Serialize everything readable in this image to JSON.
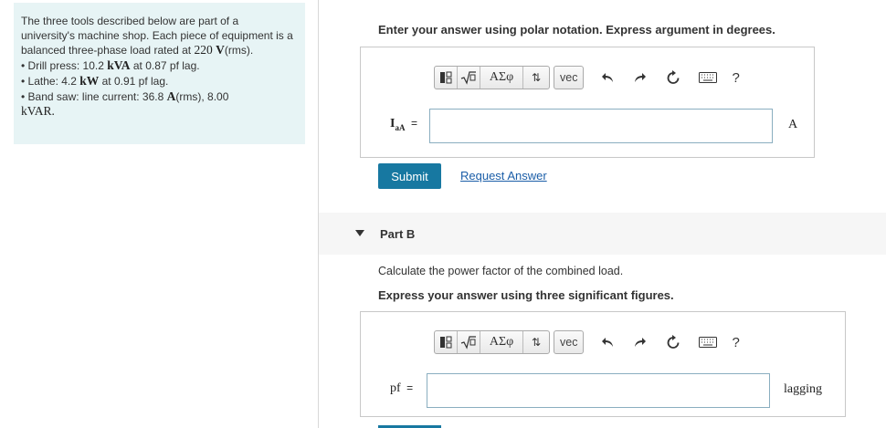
{
  "problem": {
    "intro": "The three tools described below are part of a university's machine shop. Each piece of equipment is a balanced three-phase load rated at",
    "voltage_value": "220",
    "voltage_unit": "V",
    "voltage_suffix": "(rms).",
    "drill_prefix": "• Drill press: 10.2",
    "drill_unit": "kVA",
    "drill_suffix": "at 0.87 pf lag.",
    "lathe_prefix": "• Lathe: 4.2",
    "lathe_unit": "kW",
    "lathe_suffix": "at 0.91 pf lag.",
    "saw_prefix": "• Band saw: line current: 36.8",
    "saw_unit": "A",
    "saw_suffix": "(rms), 8.00",
    "saw_unit2": "kVAR."
  },
  "partA": {
    "instruction": "Enter your answer using polar notation. Express argument in degrees.",
    "var_main": "I",
    "var_sub": "aA",
    "equals": "=",
    "input_value": "",
    "unit": "A",
    "submit_label": "Submit",
    "request_label": "Request Answer"
  },
  "toolbar": {
    "greek_label": "ΑΣφ",
    "arrows_label": "⇅",
    "vec_label": "vec",
    "help_label": "?"
  },
  "partB": {
    "title": "Part B",
    "question": "Calculate the power factor of the combined load.",
    "instruction": "Express your answer using three significant figures.",
    "var_label": "pf",
    "equals": "=",
    "input_value": "",
    "unit": "lagging"
  }
}
